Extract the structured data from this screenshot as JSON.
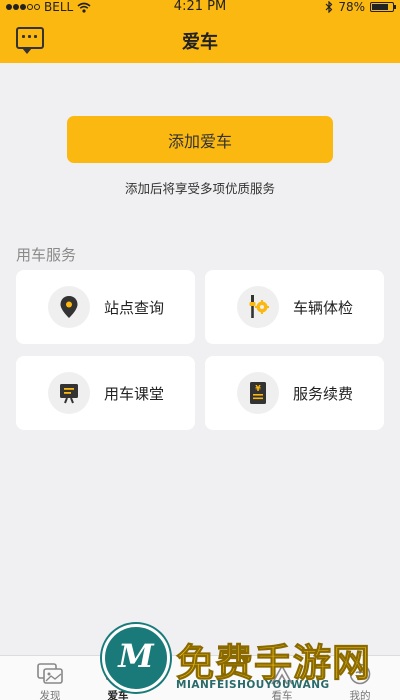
{
  "status_bar": {
    "carrier": "BELL",
    "time": "4:21 PM",
    "battery": "78%",
    "battery_level": 0.78
  },
  "header": {
    "title": "爱车",
    "message_icon": "message-icon"
  },
  "add_car": {
    "button_label": "添加爱车",
    "hint": "添加后将享受多项优质服务"
  },
  "services": {
    "section_title": "用车服务",
    "items": [
      {
        "label": "站点查询",
        "icon": "location-pin-icon"
      },
      {
        "label": "车辆体检",
        "icon": "inspection-tools-icon"
      },
      {
        "label": "用车课堂",
        "icon": "classroom-board-icon"
      },
      {
        "label": "服务续费",
        "icon": "renewal-receipt-icon"
      }
    ]
  },
  "tabbar": {
    "items": [
      {
        "label": "发现",
        "icon": "discover-icon",
        "active": false
      },
      {
        "label": "爱车",
        "icon": "car-icon",
        "active": true
      },
      {
        "label": "看车",
        "icon": "view-car-icon",
        "active": false
      },
      {
        "label": "我的",
        "icon": "profile-icon",
        "active": false
      }
    ]
  },
  "watermark": {
    "logo_letter": "M",
    "title": "免费手游网",
    "subtitle": "MIANFEISHOUYOUWANG",
    "colors": {
      "gold": "#f6c419",
      "teal": "#1a7a7a"
    }
  },
  "colors": {
    "accent": "#fbb810",
    "background": "#f0f0f2",
    "card": "#ffffff",
    "icon_circle": "#efefef"
  }
}
